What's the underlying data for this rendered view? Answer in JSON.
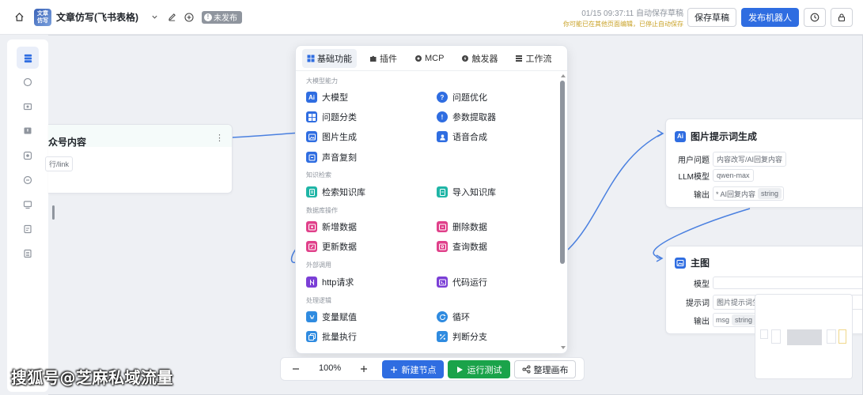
{
  "header": {
    "app_logo_text": "文章\n仿写",
    "title": "文章仿写(飞书表格)",
    "status_badge": "未发布",
    "save_time": "01/15 09:37:11 自动保存草稿",
    "save_warning": "你可能已在其他页面编辑，已停止自动保存",
    "save_draft_label": "保存草稿",
    "publish_label": "发布机器人"
  },
  "left_node": {
    "title": "众号内容",
    "chip": "行/link"
  },
  "popup": {
    "tabs": [
      {
        "label": "基础功能",
        "icon": "grid-icon"
      },
      {
        "label": "插件",
        "icon": "puzzle-icon"
      },
      {
        "label": "MCP",
        "icon": "mcp-icon"
      },
      {
        "label": "触发器",
        "icon": "trigger-icon"
      },
      {
        "label": "工作流",
        "icon": "workflow-icon"
      }
    ],
    "sections": {
      "s1": "大模型能力",
      "s2": "知识检索",
      "s3": "数据库操作",
      "s4": "外部调用",
      "s5": "处理逻辑"
    },
    "items": {
      "llm": "大模型",
      "question_opt": "问题优化",
      "question_cls": "问题分类",
      "param_extract": "参数提取器",
      "image_gen": "图片生成",
      "tts": "语音合成",
      "voice_clone": "声音复刻",
      "kb_search": "检索知识库",
      "kb_import": "导入知识库",
      "db_insert": "新增数据",
      "db_delete": "删除数据",
      "db_update": "更新数据",
      "db_query": "查询数据",
      "http": "http请求",
      "code": "代码运行",
      "var_assign": "变量赋值",
      "loop": "循环",
      "batch": "批量执行",
      "branch": "判断分支"
    }
  },
  "node_prompt": {
    "title": "图片提示词生成",
    "rows": [
      {
        "label": "用户问题",
        "value": "内容改写/AI回复内容"
      },
      {
        "label": "LLM模型",
        "value": "qwen-max"
      },
      {
        "label": "输出",
        "value": "* AI回复内容",
        "type": "string"
      }
    ]
  },
  "node_main": {
    "title": "主图",
    "rows": [
      {
        "label": "模型",
        "value": ""
      },
      {
        "label": "提示词",
        "value": "图片提示词生"
      },
      {
        "label": "输出",
        "value": "msg",
        "type": "string"
      }
    ]
  },
  "toolbar": {
    "zoom": "100%",
    "new_node": "新建节点",
    "run_test": "运行测试",
    "arrange": "整理画布"
  },
  "watermark": "搜狐号@芝麻私域流量",
  "colors": {
    "primary": "#2f6de1",
    "success": "#1aa34a",
    "warning": "#c9a227"
  }
}
